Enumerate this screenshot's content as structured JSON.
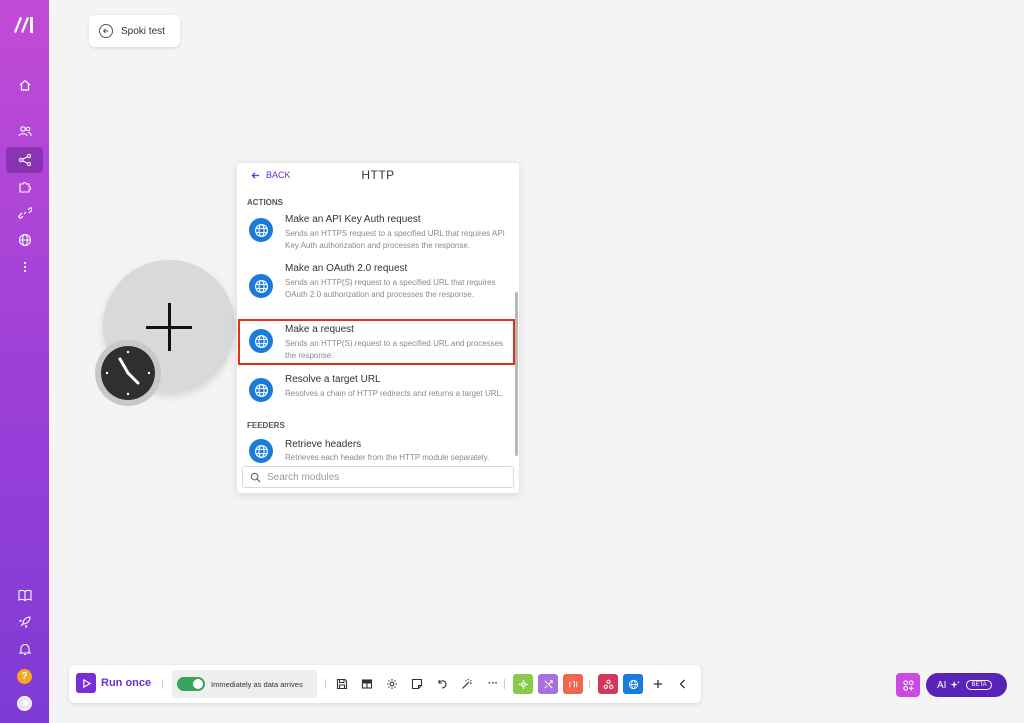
{
  "scenario": {
    "title": "Spoki test"
  },
  "sidebar": {
    "items": [
      "home",
      "team",
      "scenarios",
      "apps",
      "connections",
      "webhooks",
      "more"
    ],
    "bottom": [
      "docs",
      "whats-new",
      "notifications",
      "help",
      "profile"
    ],
    "help_label": "?"
  },
  "panel": {
    "back_label": "BACK",
    "title": "HTTP",
    "sections": {
      "actions": "ACTIONS",
      "feeders": "FEEDERS"
    },
    "modules": [
      {
        "name": "Make an API Key Auth request",
        "desc": "Sends an HTTPS request to a specified URL that requires API Key Auth authorization and processes the response."
      },
      {
        "name": "Make an OAuth 2.0 request",
        "desc": "Sends an HTTP(S) request to a specified URL that requires OAuth 2.0 authorization and processes the response."
      },
      {
        "name": "Make a request",
        "desc": "Sends an HTTP(S) request to a specified URL and processes the response."
      },
      {
        "name": "Resolve a target URL",
        "desc": "Resolves a chain of HTTP redirects and returns a target URL."
      },
      {
        "name": "Retrieve headers",
        "desc": "Retrieves each header from the HTTP module separately."
      }
    ],
    "search_placeholder": "Search modules"
  },
  "toolbar": {
    "run_label": "Run once",
    "schedule_label": "Immediately as data arrives",
    "ellipsis": "···",
    "chip_colors": {
      "tools": "#8cc84b",
      "flow": "#a96fe0",
      "text": "#f0674b",
      "graph": "#d4375c",
      "http": "#1a7cd8"
    }
  },
  "ai": {
    "label": "AI",
    "badge": "BETA"
  },
  "colors": {
    "accent": "#6d2fd6",
    "highlight": "#e53012",
    "http_blue": "#1a7cd8"
  }
}
